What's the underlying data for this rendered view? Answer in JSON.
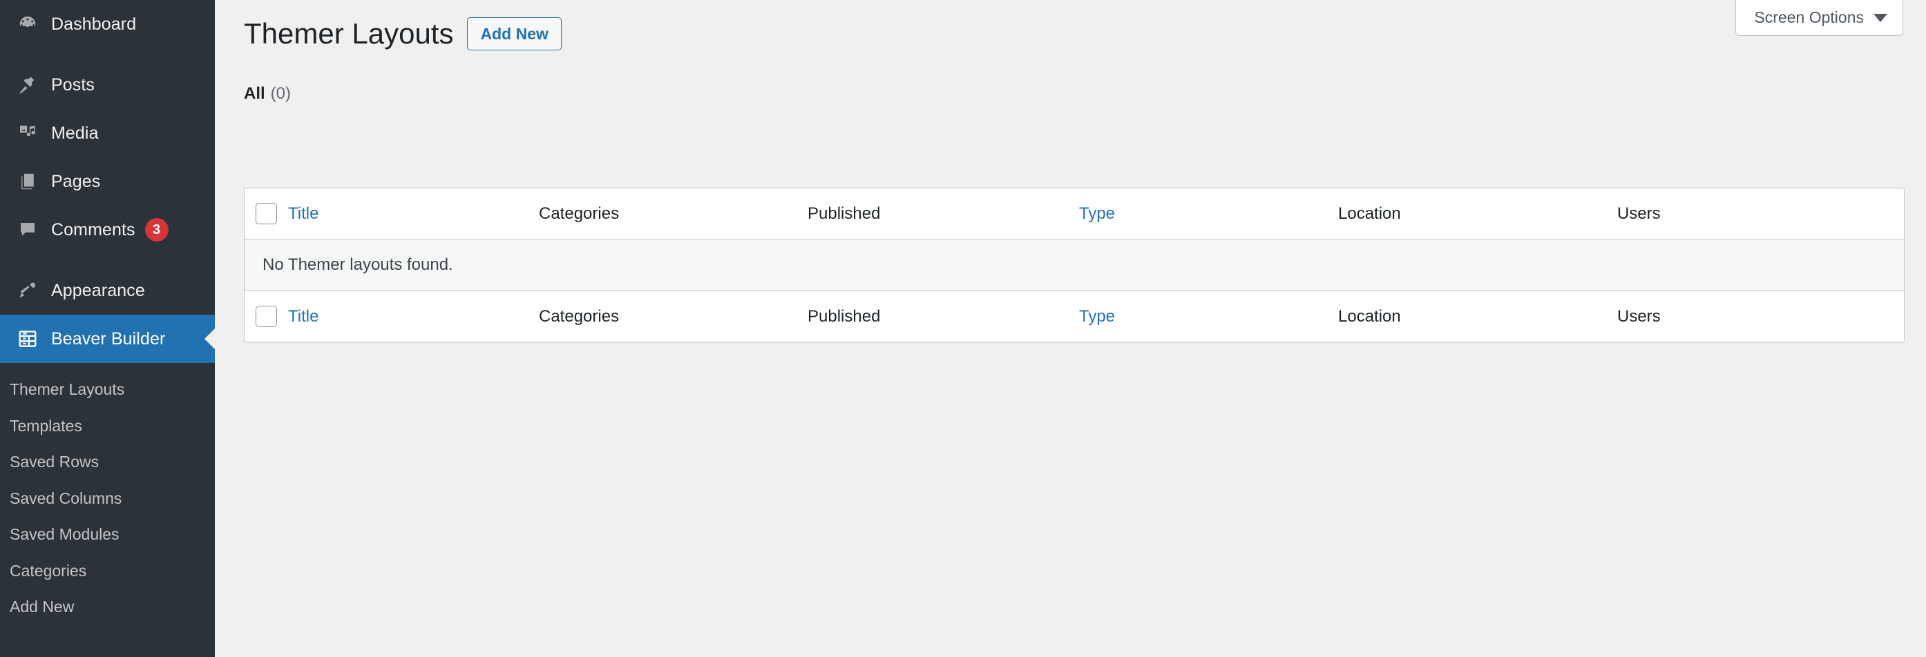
{
  "sidebar": {
    "items": [
      {
        "label": "Dashboard",
        "icon": "dashboard-icon",
        "current": false,
        "badge": null
      },
      {
        "label": "Posts",
        "icon": "pin-icon",
        "current": false,
        "badge": null
      },
      {
        "label": "Media",
        "icon": "media-icon",
        "current": false,
        "badge": null
      },
      {
        "label": "Pages",
        "icon": "pages-icon",
        "current": false,
        "badge": null
      },
      {
        "label": "Comments",
        "icon": "comments-icon",
        "current": false,
        "badge": "3"
      },
      {
        "label": "Appearance",
        "icon": "brush-icon",
        "current": false,
        "badge": null
      },
      {
        "label": "Beaver Builder",
        "icon": "beaver-builder-icon",
        "current": true,
        "badge": null
      }
    ],
    "submenu": [
      {
        "label": "Themer Layouts"
      },
      {
        "label": "Templates"
      },
      {
        "label": "Saved Rows"
      },
      {
        "label": "Saved Columns"
      },
      {
        "label": "Saved Modules"
      },
      {
        "label": "Categories"
      },
      {
        "label": "Add New"
      }
    ]
  },
  "screen_meta": {
    "screen_options_label": "Screen Options",
    "caret_icon": "chevron-down-icon"
  },
  "header": {
    "title": "Themer Layouts",
    "add_new_label": "Add New"
  },
  "filters": {
    "all_label": "All",
    "all_count": "(0)"
  },
  "table": {
    "columns": [
      {
        "key": "title",
        "label": "Title",
        "sortable": true
      },
      {
        "key": "categories",
        "label": "Categories",
        "sortable": false
      },
      {
        "key": "published",
        "label": "Published",
        "sortable": false
      },
      {
        "key": "type",
        "label": "Type",
        "sortable": true
      },
      {
        "key": "location",
        "label": "Location",
        "sortable": false
      },
      {
        "key": "users",
        "label": "Users",
        "sortable": false
      }
    ],
    "rows": [],
    "empty_message": "No Themer layouts found."
  },
  "colors": {
    "sidebar_bg": "#2c3338",
    "current_menu_bg": "#2271b1",
    "link_blue": "#2271b1",
    "badge_red": "#d63638",
    "content_bg": "#f0f0f1",
    "table_border": "#c3c4c7",
    "empty_row_bg": "#f6f7f7"
  }
}
